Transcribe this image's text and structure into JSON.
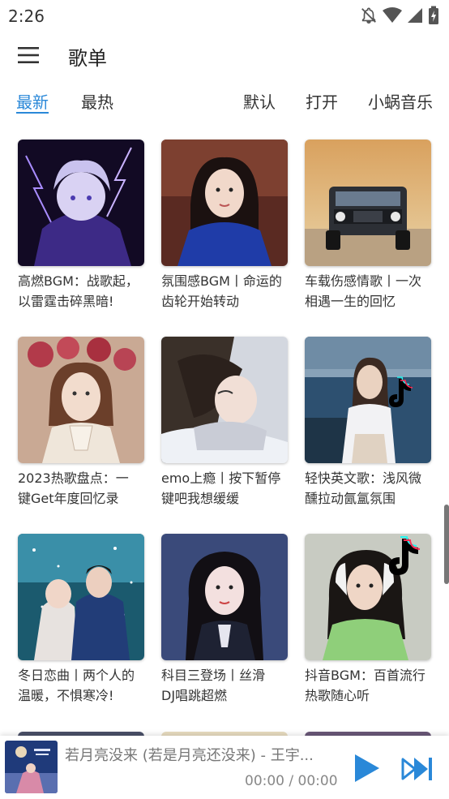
{
  "status_bar": {
    "time": "2:26",
    "icons": [
      "notifications-off-icon",
      "wifi-icon",
      "cell-signal-icon",
      "battery-charging-icon"
    ]
  },
  "app_bar": {
    "title": "歌单",
    "menu_icon": "hamburger-menu-icon"
  },
  "tabs": {
    "left": [
      {
        "label": "最新",
        "active": true
      },
      {
        "label": "最热",
        "active": false
      }
    ],
    "right": [
      {
        "label": "默认"
      },
      {
        "label": "打开"
      },
      {
        "label": "小蜗音乐"
      }
    ]
  },
  "playlists": [
    {
      "title": "高燃BGM：战歌起，\n以雷霆击碎黑暗!"
    },
    {
      "title": "氛围感BGM丨命运的\n齿轮开始转动"
    },
    {
      "title": "车载伤感情歌丨一次\n相遇一生的回忆"
    },
    {
      "title": "2023热歌盘点：一\n键Get年度回忆录"
    },
    {
      "title": "emo上瘾丨按下暂停\n键吧我想缓缓"
    },
    {
      "title": "轻快英文歌：浅风微\n醺拉动氤氲氛围"
    },
    {
      "title": "冬日恋曲丨两个人的\n温暖，不惧寒冷!"
    },
    {
      "title": "科目三登场丨丝滑\nDJ唱跳超燃"
    },
    {
      "title": "抖音BGM：百首流行\n热歌随心听"
    }
  ],
  "player": {
    "song_title": "若月亮没来 (若是月亮还没来) - 王宇...",
    "time_display": "00:00 / 00:00",
    "accent_color": "#2a88d8"
  }
}
